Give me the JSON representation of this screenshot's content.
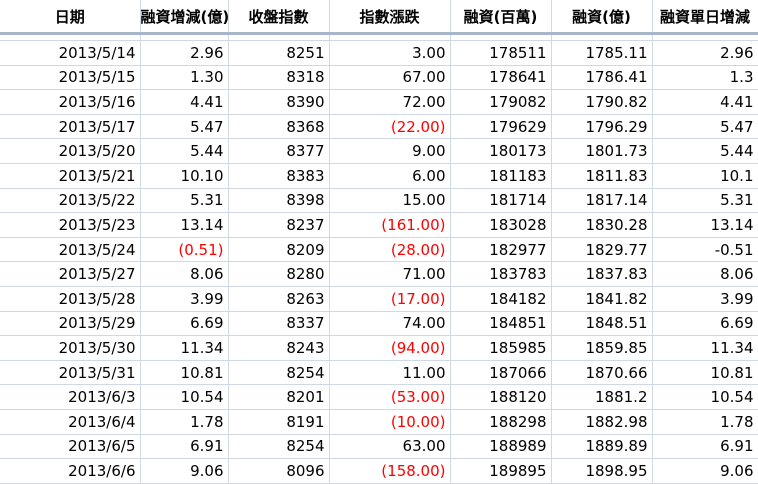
{
  "headers": [
    "日期",
    "融資增減(億)",
    "收盤指數",
    "指數漲跌",
    "融資(百萬)",
    "融資(億)",
    "融資單日增減"
  ],
  "rows": [
    {
      "date": "2013/5/14",
      "chg": "2.96",
      "close": "8251",
      "idx": "3.00",
      "m": "178511",
      "y": "1785.11",
      "day": "2.96"
    },
    {
      "date": "2013/5/15",
      "chg": "1.30",
      "close": "8318",
      "idx": "67.00",
      "m": "178641",
      "y": "1786.41",
      "day": "1.3"
    },
    {
      "date": "2013/5/16",
      "chg": "4.41",
      "close": "8390",
      "idx": "72.00",
      "m": "179082",
      "y": "1790.82",
      "day": "4.41"
    },
    {
      "date": "2013/5/17",
      "chg": "5.47",
      "close": "8368",
      "idx": "(22.00)",
      "m": "179629",
      "y": "1796.29",
      "day": "5.47"
    },
    {
      "date": "2013/5/20",
      "chg": "5.44",
      "close": "8377",
      "idx": "9.00",
      "m": "180173",
      "y": "1801.73",
      "day": "5.44"
    },
    {
      "date": "2013/5/21",
      "chg": "10.10",
      "close": "8383",
      "idx": "6.00",
      "m": "181183",
      "y": "1811.83",
      "day": "10.1"
    },
    {
      "date": "2013/5/22",
      "chg": "5.31",
      "close": "8398",
      "idx": "15.00",
      "m": "181714",
      "y": "1817.14",
      "day": "5.31"
    },
    {
      "date": "2013/5/23",
      "chg": "13.14",
      "close": "8237",
      "idx": "(161.00)",
      "m": "183028",
      "y": "1830.28",
      "day": "13.14"
    },
    {
      "date": "2013/5/24",
      "chg": "(0.51)",
      "close": "8209",
      "idx": "(28.00)",
      "m": "182977",
      "y": "1829.77",
      "day": "-0.51"
    },
    {
      "date": "2013/5/27",
      "chg": "8.06",
      "close": "8280",
      "idx": "71.00",
      "m": "183783",
      "y": "1837.83",
      "day": "8.06"
    },
    {
      "date": "2013/5/28",
      "chg": "3.99",
      "close": "8263",
      "idx": "(17.00)",
      "m": "184182",
      "y": "1841.82",
      "day": "3.99"
    },
    {
      "date": "2013/5/29",
      "chg": "6.69",
      "close": "8337",
      "idx": "74.00",
      "m": "184851",
      "y": "1848.51",
      "day": "6.69"
    },
    {
      "date": "2013/5/30",
      "chg": "11.34",
      "close": "8243",
      "idx": "(94.00)",
      "m": "185985",
      "y": "1859.85",
      "day": "11.34"
    },
    {
      "date": "2013/5/31",
      "chg": "10.81",
      "close": "8254",
      "idx": "11.00",
      "m": "187066",
      "y": "1870.66",
      "day": "10.81"
    },
    {
      "date": "2013/6/3",
      "chg": "10.54",
      "close": "8201",
      "idx": "(53.00)",
      "m": "188120",
      "y": "1881.2",
      "day": "10.54"
    },
    {
      "date": "2013/6/4",
      "chg": "1.78",
      "close": "8191",
      "idx": "(10.00)",
      "m": "188298",
      "y": "1882.98",
      "day": "1.78"
    },
    {
      "date": "2013/6/5",
      "chg": "6.91",
      "close": "8254",
      "idx": "63.00",
      "m": "188989",
      "y": "1889.89",
      "day": "6.91"
    },
    {
      "date": "2013/6/6",
      "chg": "9.06",
      "close": "8096",
      "idx": "(158.00)",
      "m": "189895",
      "y": "1898.95",
      "day": "9.06"
    }
  ],
  "colors": {
    "negative": "#ff0000",
    "gridline": "#d0d7e5",
    "header_border": "#a8b4cc"
  }
}
